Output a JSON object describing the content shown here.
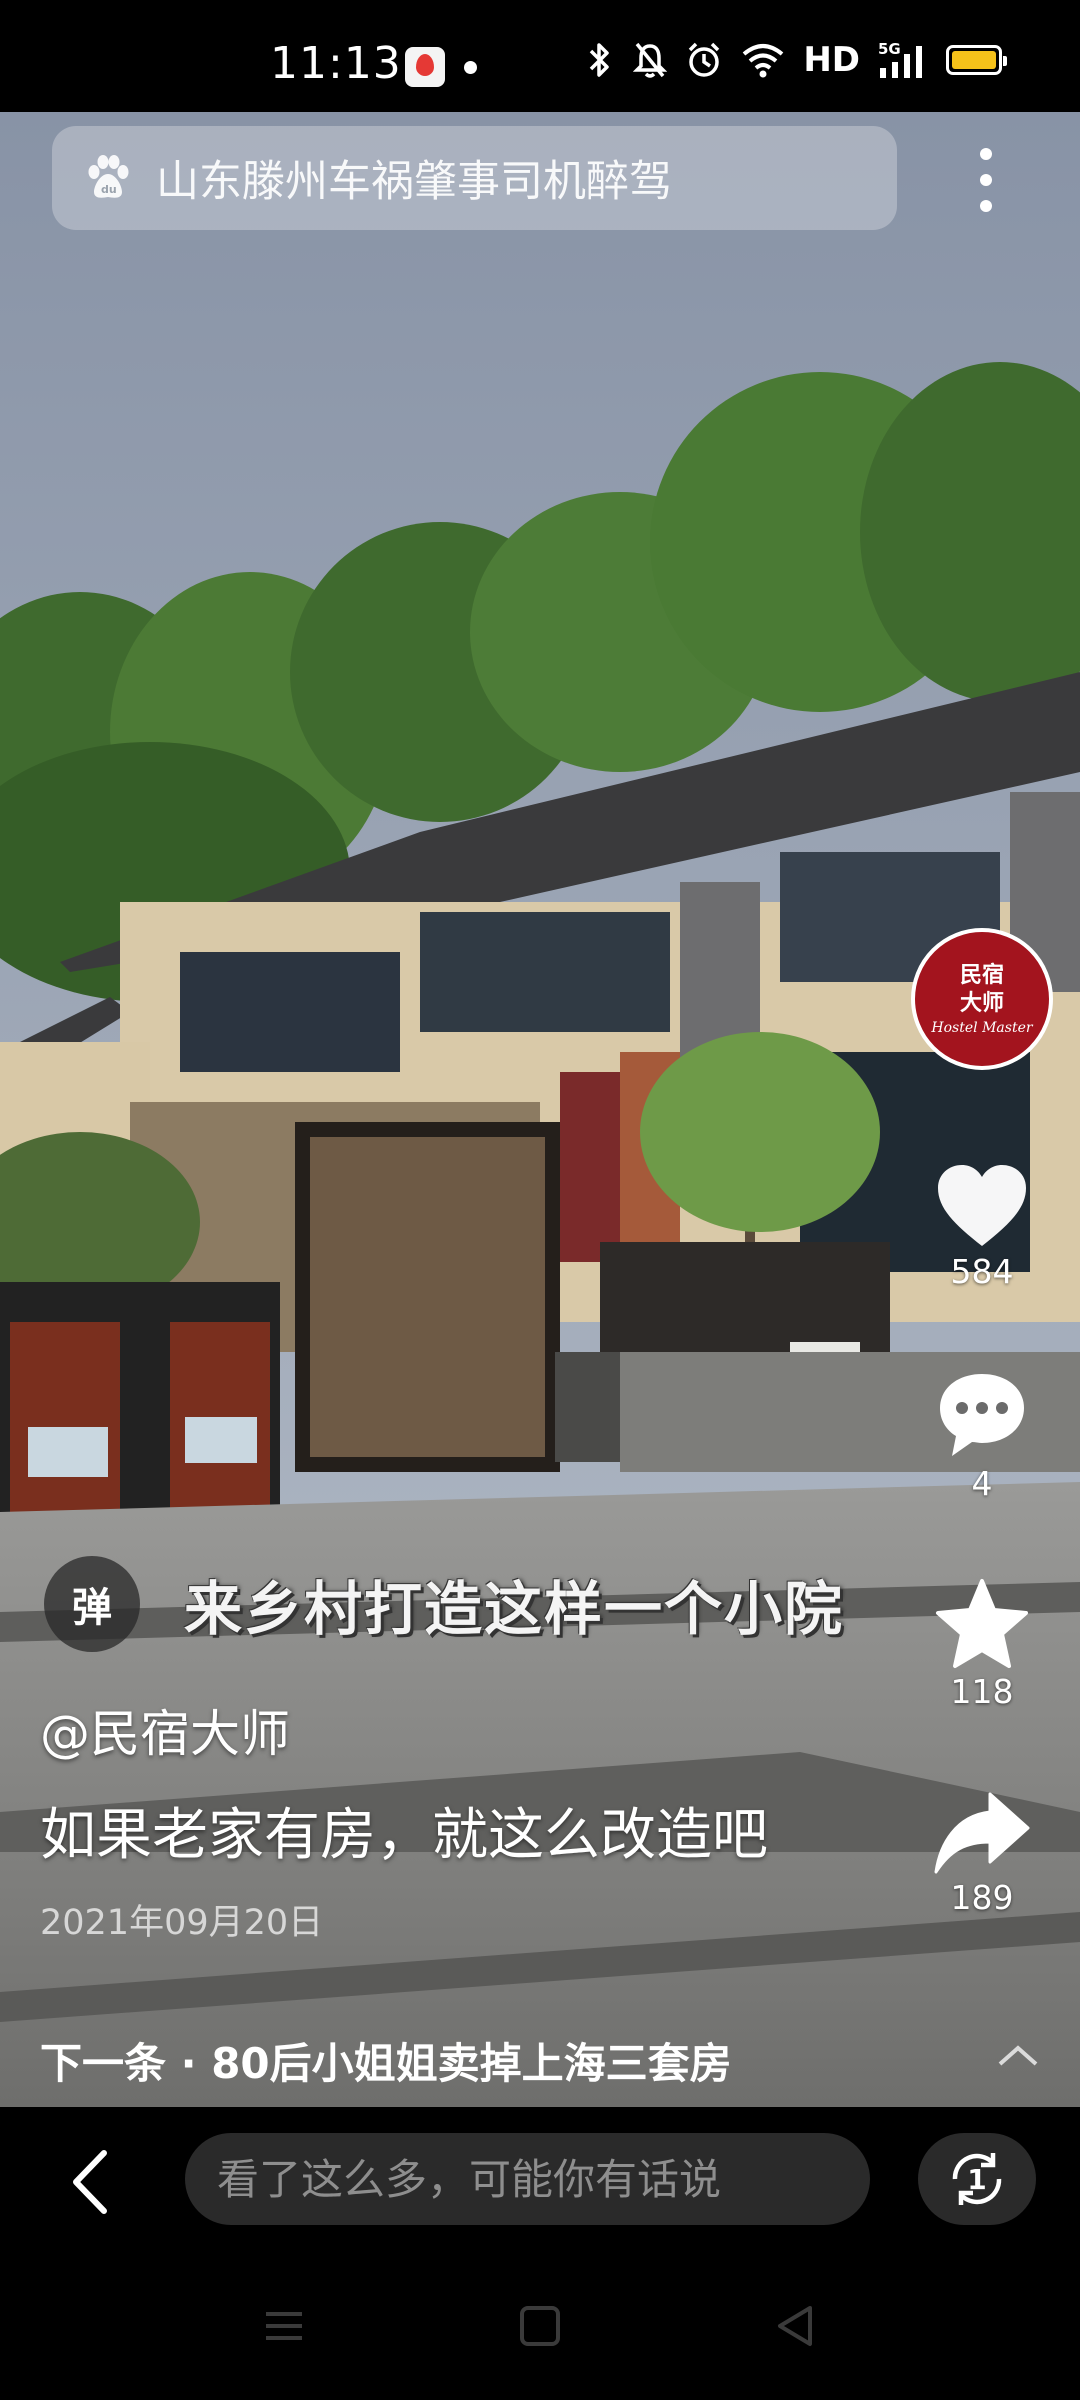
{
  "status_bar": {
    "time": "11:13",
    "network": "HD",
    "network_gen": "5G",
    "icons": [
      "baidu-map-notification-icon",
      "notification-dot",
      "bluetooth-icon",
      "mute-bell-icon",
      "alarm-icon",
      "wifi-icon",
      "signal-icon",
      "battery-icon"
    ],
    "battery_color": "#f6c21a"
  },
  "search": {
    "text": "山东滕州车祸肇事司机醉驾",
    "icon": "baidu-paw-icon"
  },
  "profile": {
    "logo_line1": "民宿",
    "logo_line2": "大师",
    "logo_line3": "Hostel Master",
    "logo_color": "#a3141e"
  },
  "actions": {
    "like_count": "584",
    "comment_count": "4",
    "favorite_count": "118",
    "share_count": "189"
  },
  "video": {
    "danmu_label": "弹",
    "caption": "来乡村打造这样一个小院",
    "author": "@民宿大师",
    "title": "如果老家有房，就这么改造吧",
    "date": "2021年09月20日"
  },
  "next": {
    "text": "下一条 · 80后小姐姐卖掉上海三套房"
  },
  "bottom": {
    "comment_placeholder": "看了这么多，可能你有话说",
    "counter_value": "1"
  }
}
